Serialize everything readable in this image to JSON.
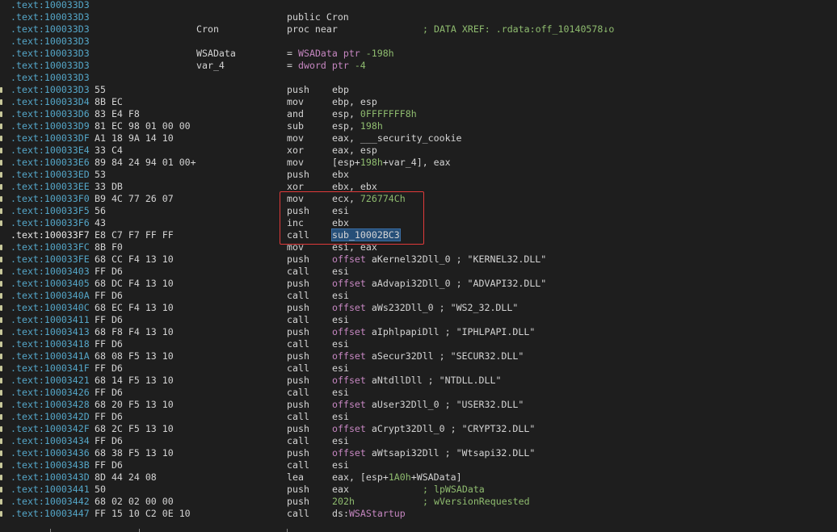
{
  "theme": {
    "bg": "#1e1e1e",
    "addr": "#54a6c8",
    "num": "#8fbc6f",
    "sym": "#c586c0",
    "box": "#e03a3a"
  },
  "lines": [
    {
      "addr": ".text:100033D3",
      "bytes": "",
      "label": "",
      "mnem": "",
      "ops": [],
      "comment": ""
    },
    {
      "addr": ".text:100033D3",
      "bytes": "",
      "label": "",
      "mnem": "public Cron",
      "ops": [],
      "comment": ""
    },
    {
      "addr": ".text:100033D3",
      "bytes": "",
      "label": "Cron",
      "mnem": "proc near",
      "ops": [],
      "comment": "; DATA XREF: .rdata:off_10140578↓o"
    },
    {
      "addr": ".text:100033D3",
      "bytes": "",
      "label": "",
      "mnem": "",
      "ops": [],
      "comment": ""
    },
    {
      "addr": ".text:100033D3",
      "bytes": "",
      "label": "WSAData",
      "mnem": "= ",
      "ops": [
        {
          "t": "WSAData ptr ",
          "c": "sym"
        },
        {
          "t": "-198h",
          "c": "num"
        }
      ],
      "comment": ""
    },
    {
      "addr": ".text:100033D3",
      "bytes": "",
      "label": "var_4",
      "mnem": "= ",
      "ops": [
        {
          "t": "dword ptr ",
          "c": "sym"
        },
        {
          "t": "-4",
          "c": "num"
        }
      ],
      "comment": ""
    },
    {
      "addr": ".text:100033D3",
      "bytes": "",
      "label": "",
      "mnem": "",
      "ops": [],
      "comment": ""
    },
    {
      "addr": ".text:100033D3",
      "bytes": "55",
      "label": "",
      "mnem": "push",
      "ops": [
        {
          "t": "ebp"
        }
      ],
      "comment": ""
    },
    {
      "addr": ".text:100033D4",
      "bytes": "8B EC",
      "label": "",
      "mnem": "mov",
      "ops": [
        {
          "t": "ebp, esp"
        }
      ],
      "comment": ""
    },
    {
      "addr": ".text:100033D6",
      "bytes": "83 E4 F8",
      "label": "",
      "mnem": "and",
      "ops": [
        {
          "t": "esp, "
        },
        {
          "t": "0FFFFFFF8h",
          "c": "num"
        }
      ],
      "comment": ""
    },
    {
      "addr": ".text:100033D9",
      "bytes": "81 EC 98 01 00 00",
      "label": "",
      "mnem": "sub",
      "ops": [
        {
          "t": "esp, "
        },
        {
          "t": "198h",
          "c": "num"
        }
      ],
      "comment": ""
    },
    {
      "addr": ".text:100033DF",
      "bytes": "A1 18 9A 14 10",
      "label": "",
      "mnem": "mov",
      "ops": [
        {
          "t": "eax, ___security_cookie"
        }
      ],
      "comment": ""
    },
    {
      "addr": ".text:100033E4",
      "bytes": "33 C4",
      "label": "",
      "mnem": "xor",
      "ops": [
        {
          "t": "eax, esp"
        }
      ],
      "comment": ""
    },
    {
      "addr": ".text:100033E6",
      "bytes": "89 84 24 94 01 00+",
      "label": "",
      "mnem": "mov",
      "ops": [
        {
          "t": "[esp+"
        },
        {
          "t": "198h",
          "c": "num"
        },
        {
          "t": "+var_4], eax"
        }
      ],
      "comment": ""
    },
    {
      "addr": ".text:100033ED",
      "bytes": "53",
      "label": "",
      "mnem": "push",
      "ops": [
        {
          "t": "ebx"
        }
      ],
      "comment": ""
    },
    {
      "addr": ".text:100033EE",
      "bytes": "33 DB",
      "label": "",
      "mnem": "xor",
      "ops": [
        {
          "t": "ebx, ebx"
        }
      ],
      "comment": ""
    },
    {
      "addr": ".text:100033F0",
      "bytes": "B9 4C 77 26 07",
      "label": "",
      "mnem": "mov",
      "ops": [
        {
          "t": "ecx, "
        },
        {
          "t": "726774Ch",
          "c": "num"
        }
      ],
      "comment": ""
    },
    {
      "addr": ".text:100033F5",
      "bytes": "56",
      "label": "",
      "mnem": "push",
      "ops": [
        {
          "t": "esi"
        }
      ],
      "comment": ""
    },
    {
      "addr": ".text:100033F6",
      "bytes": "43",
      "label": "",
      "mnem": "inc",
      "ops": [
        {
          "t": "ebx"
        }
      ],
      "comment": ""
    },
    {
      "addr": ".text:100033F7",
      "bytes": "E8 C7 F7 FF FF",
      "label": "",
      "mnem": "call",
      "ops": [
        {
          "t": "sub_10002BC3",
          "c": "sel"
        }
      ],
      "comment": "",
      "current": true
    },
    {
      "addr": ".text:100033FC",
      "bytes": "8B F0",
      "label": "",
      "mnem": "mov",
      "ops": [
        {
          "t": "esi, eax"
        }
      ],
      "comment": ""
    },
    {
      "addr": ".text:100033FE",
      "bytes": "68 CC F4 13 10",
      "label": "",
      "mnem": "push",
      "ops": [
        {
          "t": "offset ",
          "c": "sym"
        },
        {
          "t": "aKernel32Dll_0"
        },
        {
          "t": " ; \"KERNEL32.DLL\""
        }
      ],
      "comment": ""
    },
    {
      "addr": ".text:10003403",
      "bytes": "FF D6",
      "label": "",
      "mnem": "call",
      "ops": [
        {
          "t": "esi"
        }
      ],
      "comment": ""
    },
    {
      "addr": ".text:10003405",
      "bytes": "68 DC F4 13 10",
      "label": "",
      "mnem": "push",
      "ops": [
        {
          "t": "offset ",
          "c": "sym"
        },
        {
          "t": "aAdvapi32Dll_0"
        },
        {
          "t": " ; \"ADVAPI32.DLL\""
        }
      ],
      "comment": ""
    },
    {
      "addr": ".text:1000340A",
      "bytes": "FF D6",
      "label": "",
      "mnem": "call",
      "ops": [
        {
          "t": "esi"
        }
      ],
      "comment": ""
    },
    {
      "addr": ".text:1000340C",
      "bytes": "68 EC F4 13 10",
      "label": "",
      "mnem": "push",
      "ops": [
        {
          "t": "offset ",
          "c": "sym"
        },
        {
          "t": "aWs232Dll_0"
        },
        {
          "t": " ; \"WS2_32.DLL\""
        }
      ],
      "comment": ""
    },
    {
      "addr": ".text:10003411",
      "bytes": "FF D6",
      "label": "",
      "mnem": "call",
      "ops": [
        {
          "t": "esi"
        }
      ],
      "comment": ""
    },
    {
      "addr": ".text:10003413",
      "bytes": "68 F8 F4 13 10",
      "label": "",
      "mnem": "push",
      "ops": [
        {
          "t": "offset ",
          "c": "sym"
        },
        {
          "t": "aIphlpapiDll"
        },
        {
          "t": " ; \"IPHLPAPI.DLL\""
        }
      ],
      "comment": ""
    },
    {
      "addr": ".text:10003418",
      "bytes": "FF D6",
      "label": "",
      "mnem": "call",
      "ops": [
        {
          "t": "esi"
        }
      ],
      "comment": ""
    },
    {
      "addr": ".text:1000341A",
      "bytes": "68 08 F5 13 10",
      "label": "",
      "mnem": "push",
      "ops": [
        {
          "t": "offset ",
          "c": "sym"
        },
        {
          "t": "aSecur32Dll"
        },
        {
          "t": " ; \"SECUR32.DLL\""
        }
      ],
      "comment": ""
    },
    {
      "addr": ".text:1000341F",
      "bytes": "FF D6",
      "label": "",
      "mnem": "call",
      "ops": [
        {
          "t": "esi"
        }
      ],
      "comment": ""
    },
    {
      "addr": ".text:10003421",
      "bytes": "68 14 F5 13 10",
      "label": "",
      "mnem": "push",
      "ops": [
        {
          "t": "offset ",
          "c": "sym"
        },
        {
          "t": "aNtdllDll"
        },
        {
          "t": " ; \"NTDLL.DLL\""
        }
      ],
      "comment": ""
    },
    {
      "addr": ".text:10003426",
      "bytes": "FF D6",
      "label": "",
      "mnem": "call",
      "ops": [
        {
          "t": "esi"
        }
      ],
      "comment": ""
    },
    {
      "addr": ".text:10003428",
      "bytes": "68 20 F5 13 10",
      "label": "",
      "mnem": "push",
      "ops": [
        {
          "t": "offset ",
          "c": "sym"
        },
        {
          "t": "aUser32Dll_0"
        },
        {
          "t": " ; \"USER32.DLL\""
        }
      ],
      "comment": ""
    },
    {
      "addr": ".text:1000342D",
      "bytes": "FF D6",
      "label": "",
      "mnem": "call",
      "ops": [
        {
          "t": "esi"
        }
      ],
      "comment": ""
    },
    {
      "addr": ".text:1000342F",
      "bytes": "68 2C F5 13 10",
      "label": "",
      "mnem": "push",
      "ops": [
        {
          "t": "offset ",
          "c": "sym"
        },
        {
          "t": "aCrypt32Dll_0"
        },
        {
          "t": " ; \"CRYPT32.DLL\""
        }
      ],
      "comment": ""
    },
    {
      "addr": ".text:10003434",
      "bytes": "FF D6",
      "label": "",
      "mnem": "call",
      "ops": [
        {
          "t": "esi"
        }
      ],
      "comment": ""
    },
    {
      "addr": ".text:10003436",
      "bytes": "68 38 F5 13 10",
      "label": "",
      "mnem": "push",
      "ops": [
        {
          "t": "offset ",
          "c": "sym"
        },
        {
          "t": "aWtsapi32Dll"
        },
        {
          "t": " ; \"Wtsapi32.DLL\""
        }
      ],
      "comment": ""
    },
    {
      "addr": ".text:1000343B",
      "bytes": "FF D6",
      "label": "",
      "mnem": "call",
      "ops": [
        {
          "t": "esi"
        }
      ],
      "comment": ""
    },
    {
      "addr": ".text:1000343D",
      "bytes": "8D 44 24 08",
      "label": "",
      "mnem": "lea",
      "ops": [
        {
          "t": "eax, [esp+"
        },
        {
          "t": "1A0h",
          "c": "num"
        },
        {
          "t": "+WSAData]"
        }
      ],
      "comment": ""
    },
    {
      "addr": ".text:10003441",
      "bytes": "50",
      "label": "",
      "mnem": "push",
      "ops": [
        {
          "t": "eax"
        }
      ],
      "comment": "; lpWSAData"
    },
    {
      "addr": ".text:10003442",
      "bytes": "68 02 02 00 00",
      "label": "",
      "mnem": "push",
      "ops": [
        {
          "t": "202h",
          "c": "num"
        }
      ],
      "comment": "; wVersionRequested"
    },
    {
      "addr": ".text:10003447",
      "bytes": "FF 15 10 C2 0E 10",
      "label": "",
      "mnem": "call",
      "ops": [
        {
          "t": "ds:"
        },
        {
          "t": "WSAStartup",
          "c": "sym"
        }
      ],
      "comment": ""
    }
  ]
}
